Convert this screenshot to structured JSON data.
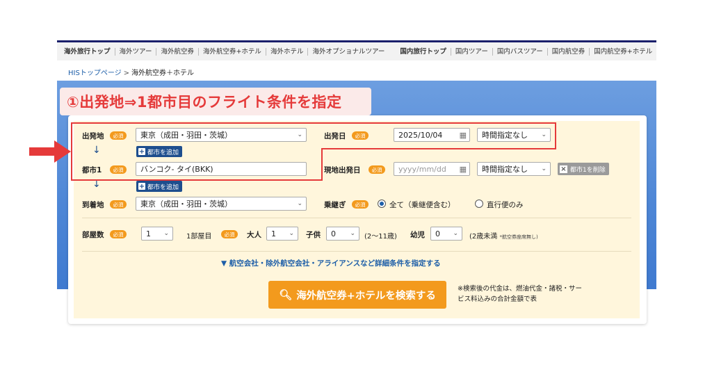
{
  "topnav": {
    "overseas": [
      "海外旅行トップ",
      "海外ツアー",
      "海外航空券",
      "海外航空券+ホテル",
      "海外ホテル",
      "海外オプショナルツアー"
    ],
    "domestic": [
      "国内旅行トップ",
      "国内ツアー",
      "国内バスツアー",
      "国内航空券",
      "国内航空券+ホテル"
    ]
  },
  "breadcrumb": {
    "home": "HISトップページ",
    "sep": ">",
    "current": "海外航空券＋ホテル"
  },
  "banner": "①出発地⇒1都市目のフライト条件を指定",
  "required_badge": "必須",
  "form": {
    "departure_label": "出発地",
    "departure_value": "東京（成田・羽田・茨城）",
    "departure_date_label": "出発日",
    "departure_date_value": "2025/10/04",
    "time_value": "時間指定なし",
    "add_city": "都市を追加",
    "city1_label": "都市1",
    "city1_value": "バンコク- タイ(BKK)",
    "local_date_label": "現地出発日",
    "local_date_placeholder": "yyyy/mm/dd",
    "local_time_value": "時間指定なし",
    "delete_city": "都市1を削除",
    "arrival_label": "到着地",
    "arrival_value": "東京（成田・羽田・茨城）",
    "transfer_label": "乗継ぎ",
    "transfer_all": "全て（乗継便含む）",
    "transfer_direct": "直行便のみ",
    "rooms_label": "部屋数",
    "rooms_value": "1",
    "room1_label": "1部屋目",
    "adult_label": "大人",
    "adult_value": "1",
    "child_label": "子供",
    "child_value": "0",
    "child_note": "(2〜11歳)",
    "infant_label": "幼児",
    "infant_value": "0",
    "infant_note": "(2歳未満",
    "infant_subnote": "*航空券座席無し)",
    "detail_link": "▼ 航空会社・除外航空会社・アライアンスなど詳細条件を指定する",
    "search_button": "海外航空券+ホテルを検索する",
    "note": "※検索後の代金は、燃油代金・諸税・サービス料込みの合計金額で表"
  },
  "colors": {
    "accent": "#f39a1d",
    "highlight": "#e53a3a",
    "link": "#1d5ea8"
  }
}
